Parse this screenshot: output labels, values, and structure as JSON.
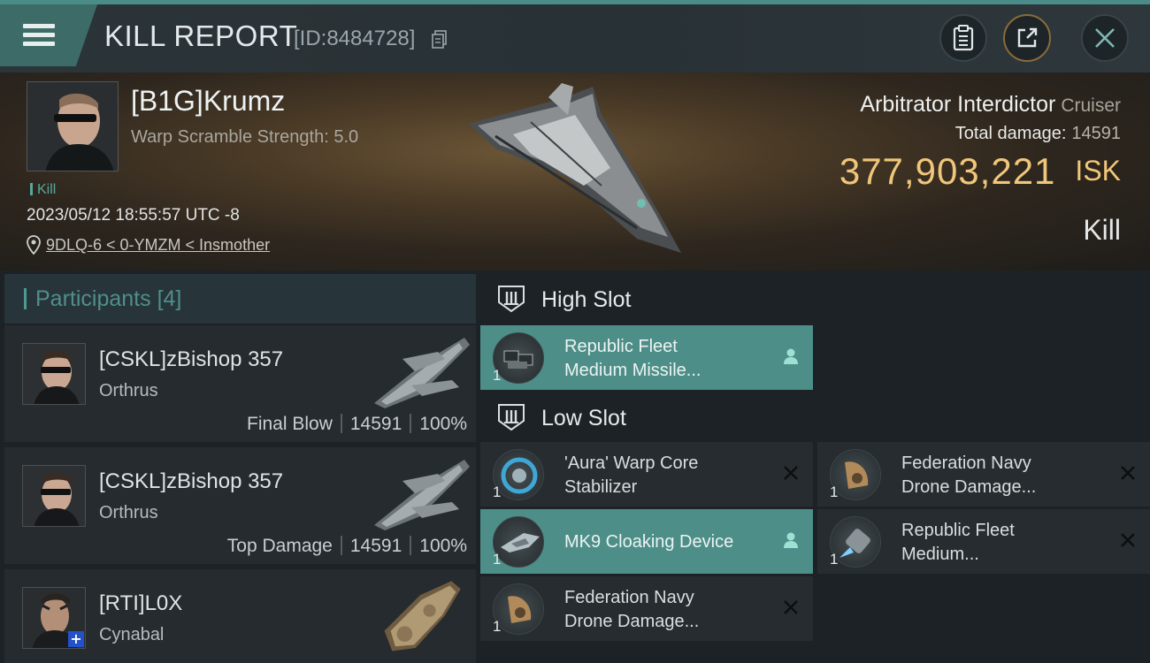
{
  "header": {
    "title": "KILL REPORT",
    "report_id": "[ID:8484728]",
    "icons": [
      "menu-icon",
      "copy-icon",
      "clipboard-icon",
      "share-icon",
      "close-icon"
    ]
  },
  "victim": {
    "name": "[B1G]Krumz",
    "subtitle": "Warp Scramble Strength: 5.0",
    "kill_tag": "Kill",
    "datetime": "2023/05/12 18:55:57 UTC -8",
    "location": "9DLQ-6 < 0-YMZM < Insmother",
    "ship_name": "Arbitrator Interdictor",
    "ship_class": "Cruiser",
    "total_damage_label": "Total damage:",
    "total_damage_value": "14591",
    "isk_value": "377,903,221",
    "isk_unit": "ISK",
    "result": "Kill"
  },
  "participants": {
    "title": "Participants",
    "count": "[4]",
    "list": [
      {
        "name": "[CSKL]zBishop 357",
        "ship": "Orthrus",
        "role": "Final Blow",
        "damage": "14591",
        "percent": "100%"
      },
      {
        "name": "[CSKL]zBishop 357",
        "ship": "Orthrus",
        "role": "Top Damage",
        "damage": "14591",
        "percent": "100%"
      },
      {
        "name": "[RTI]L0X",
        "ship": "Cynabal",
        "role": "",
        "damage": "",
        "percent": ""
      }
    ]
  },
  "fitting": {
    "high_slot": {
      "title": "High Slot",
      "modules": [
        {
          "qty": "1",
          "name": "Republic Fleet\nMedium Missile...",
          "highlight": true,
          "tag": "person"
        }
      ]
    },
    "low_slot": {
      "title": "Low Slot",
      "modules": [
        {
          "qty": "1",
          "name": "'Aura' Warp Core\nStabilizer",
          "highlight": false,
          "tag": "destroyed"
        },
        {
          "qty": "1",
          "name": "Federation Navy\nDrone Damage...",
          "highlight": false,
          "tag": "destroyed"
        },
        {
          "qty": "1",
          "name": "MK9 Cloaking Device",
          "highlight": true,
          "tag": "person"
        },
        {
          "qty": "1",
          "name": "Republic Fleet\nMedium...",
          "highlight": false,
          "tag": "destroyed"
        },
        {
          "qty": "1",
          "name": "Federation Navy\nDrone Damage...",
          "highlight": false,
          "tag": "destroyed"
        }
      ]
    }
  },
  "colors": {
    "accent": "#4d8f88",
    "isk": "#f0c77a",
    "highlight_row": "#4d8f88"
  }
}
